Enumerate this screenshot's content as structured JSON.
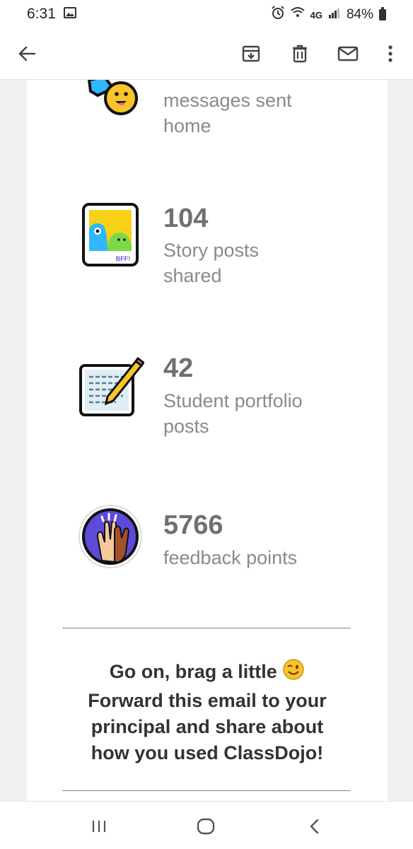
{
  "status_bar": {
    "time": "6:31",
    "network": "4G",
    "battery": "84%"
  },
  "app_bar": {
    "back_icon": "arrow-left-icon",
    "actions": [
      "archive-icon",
      "delete-icon",
      "mail-icon",
      "more-vert-icon"
    ]
  },
  "stats": [
    {
      "number": "",
      "label": "messages sent home",
      "icon": "messages-sticker-icon"
    },
    {
      "number": "104",
      "label": "Story posts shared",
      "icon": "story-photo-icon"
    },
    {
      "number": "42",
      "label": "Student portfolio posts",
      "icon": "portfolio-notepad-icon"
    },
    {
      "number": "5766",
      "label": "feedback points",
      "icon": "high-five-icon"
    }
  ],
  "stat_labels": {
    "s0_line1": "messages sent",
    "s0_line2": "home",
    "s1_line1": "Story posts",
    "s1_line2": "shared",
    "s2_line1": "Student portfolio",
    "s2_line2": "posts",
    "s3_line1": "feedback points"
  },
  "photo_sticker_text": "BFF!",
  "brag": {
    "line1": "Go on, brag a little",
    "line2": "Forward this email to your",
    "line3": "principal and share about",
    "line4": "how you used ClassDojo!"
  },
  "nav_bar": [
    "recents-icon",
    "home-icon",
    "back-icon"
  ],
  "colors": {
    "number_gray": "#707070",
    "label_gray": "#8a8a8a",
    "brag_text": "#333333",
    "sticker_blue": "#2fb8ff",
    "emoji_yellow": "#f7c52a",
    "highfive_purple": "#5b4bd8"
  }
}
